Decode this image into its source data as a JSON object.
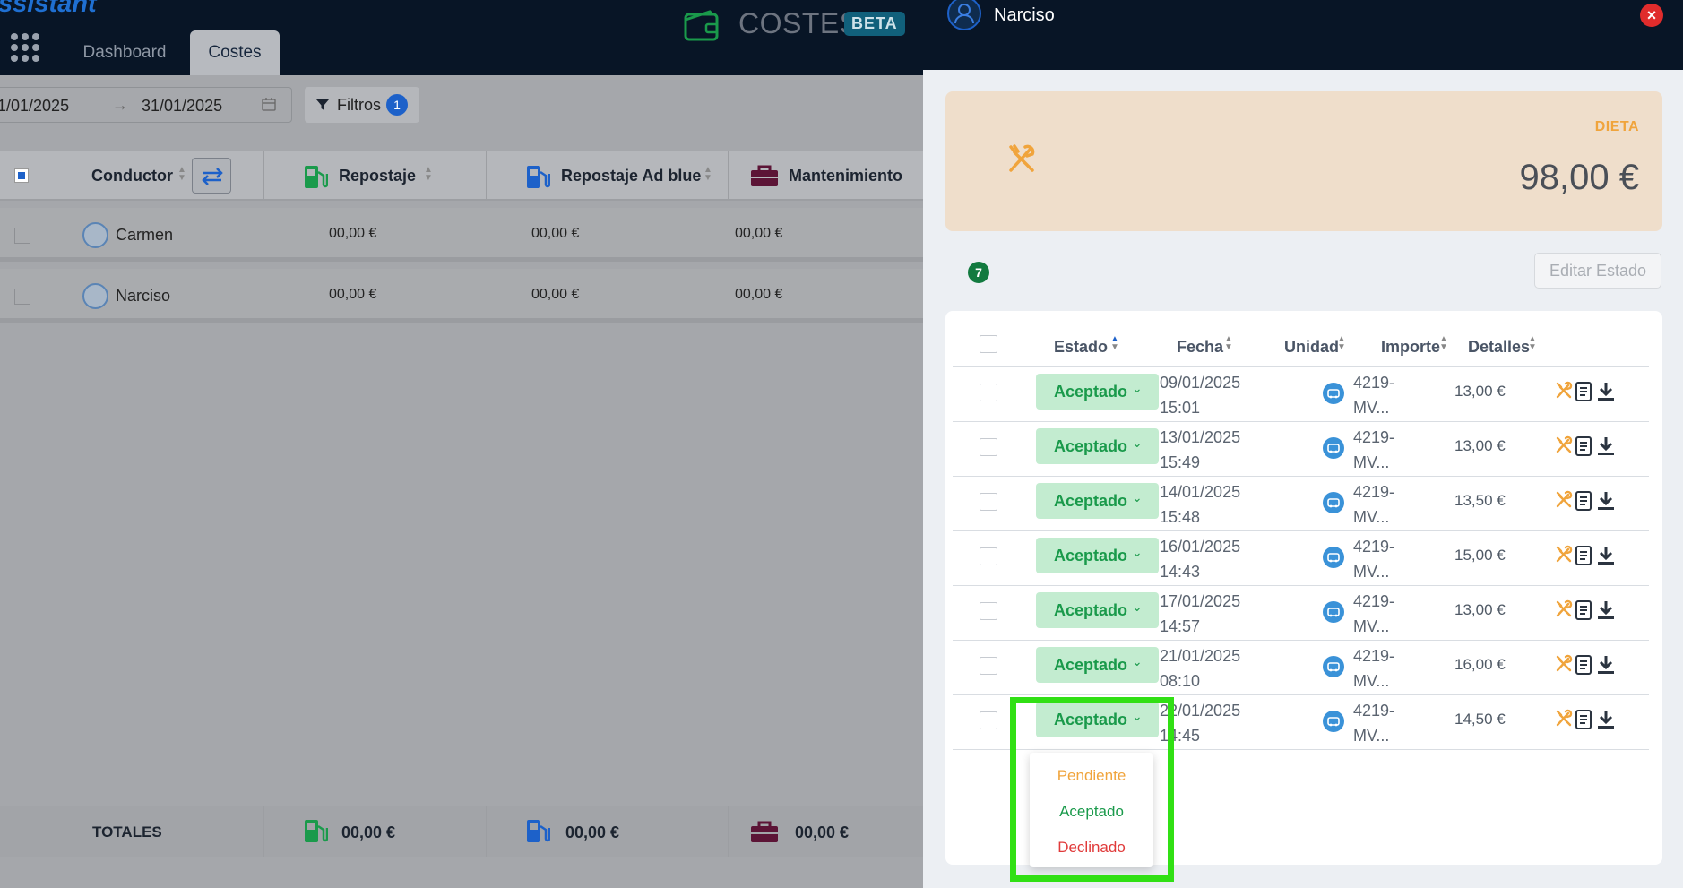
{
  "app": {
    "brand": "ssistant",
    "nav_tabs": [
      "Dashboard",
      "Costes"
    ],
    "section_title": "COSTES",
    "beta_label": "BETA"
  },
  "filters": {
    "date_start": "1/01/2025",
    "date_end": "31/01/2025",
    "filter_label": "Filtros",
    "filter_count": "1"
  },
  "table": {
    "columns": [
      "Conductor",
      "Repostaje",
      "Repostaje Ad blue",
      "Mantenimiento"
    ],
    "rows": [
      {
        "name": "Carmen",
        "values": [
          "00,00 €",
          "00,00 €",
          "00,00 €"
        ]
      },
      {
        "name": "Narciso",
        "values": [
          "00,00 €",
          "00,00 €",
          "00,00 €"
        ]
      }
    ],
    "totals_label": "TOTALES",
    "totals": [
      "00,00 €",
      "00,00 €",
      "00,00 €"
    ]
  },
  "drawer": {
    "title": "Narciso",
    "category_label": "DIETA",
    "category_amount": "98,00 €",
    "item_count": "7",
    "edit_button": "Editar Estado",
    "columns": [
      "Estado",
      "Fecha",
      "Unidad",
      "Importe",
      "Detalles"
    ],
    "rows": [
      {
        "estado": "Aceptado",
        "fecha": "09/01/2025",
        "hora": "15:01",
        "unidad1": "4219-",
        "unidad2": "MV...",
        "importe": "13,00 €"
      },
      {
        "estado": "Aceptado",
        "fecha": "13/01/2025",
        "hora": "15:49",
        "unidad1": "4219-",
        "unidad2": "MV...",
        "importe": "13,00 €"
      },
      {
        "estado": "Aceptado",
        "fecha": "14/01/2025",
        "hora": "15:48",
        "unidad1": "4219-",
        "unidad2": "MV...",
        "importe": "13,50 €"
      },
      {
        "estado": "Aceptado",
        "fecha": "16/01/2025",
        "hora": "14:43",
        "unidad1": "4219-",
        "unidad2": "MV...",
        "importe": "15,00 €"
      },
      {
        "estado": "Aceptado",
        "fecha": "17/01/2025",
        "hora": "14:57",
        "unidad1": "4219-",
        "unidad2": "MV...",
        "importe": "13,00 €"
      },
      {
        "estado": "Aceptado",
        "fecha": "21/01/2025",
        "hora": "08:10",
        "unidad1": "4219-",
        "unidad2": "MV...",
        "importe": "16,00 €"
      },
      {
        "estado": "Aceptado",
        "fecha": "22/01/2025",
        "hora": "14:45",
        "unidad1": "4219-",
        "unidad2": "MV...",
        "importe": "14,50 €"
      }
    ],
    "dropdown_options": [
      {
        "label": "Pendiente",
        "color": "#f0a43c"
      },
      {
        "label": "Aceptado",
        "color": "#1a9a4b"
      },
      {
        "label": "Declinado",
        "color": "#e03a3a"
      }
    ]
  },
  "colors": {
    "accent_blue": "#1d61c9",
    "status_green": "#1a9a4b",
    "dieta_orange": "#f0a43c",
    "highlight_green": "#31e014"
  }
}
